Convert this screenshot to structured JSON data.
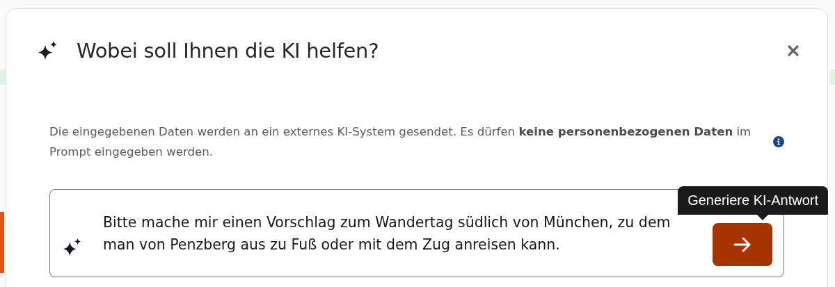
{
  "dialog": {
    "title": "Wobei soll Ihnen die KI helfen?",
    "notice": "Die eingegebenen Daten werden an ein externes KI-System gesendet. Es dürfen **keine personenbezogenen Daten** im Prompt eingegeben werden.",
    "prompt": {
      "lines": [
        "Bitte mache mir einen Vorschlag zum Wandertag südlich von München, zu dem",
        "man von Penzberg aus zu Fuß oder mit dem Zug anreisen kann."
      ]
    },
    "send_button": {
      "tooltip": "Generiere KI-Antwort"
    }
  }
}
